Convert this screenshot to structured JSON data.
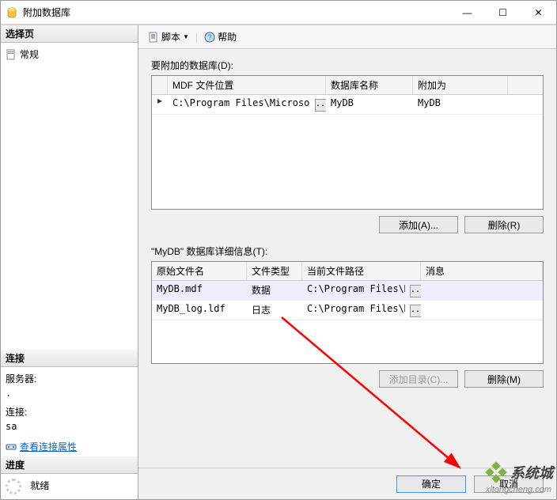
{
  "window": {
    "title": "附加数据库"
  },
  "titlebar_controls": {
    "min": "—",
    "max": "☐",
    "close": "✕"
  },
  "sidebar": {
    "select_page_header": "选择页",
    "general_item": "常规",
    "connection_header": "连接",
    "server_label": "服务器:",
    "server_value": ".",
    "conn_label": "连接:",
    "conn_value": "sa",
    "view_props_link": "查看连接属性",
    "progress_header": "进度",
    "ready_label": "就绪"
  },
  "toolbar": {
    "script_label": "脚本",
    "help_label": "帮助"
  },
  "databases": {
    "label": "要附加的数据库(D):",
    "columns": {
      "mdf": "MDF 文件位置",
      "dbname": "数据库名称",
      "attachas": "附加为"
    },
    "rows": [
      {
        "mdf": "C:\\Program Files\\Microsoft ...",
        "dbname": "MyDB",
        "attachas": "MyDB"
      }
    ],
    "add_btn": "添加(A)...",
    "remove_btn": "删除(R)"
  },
  "details": {
    "label": "\"MyDB\" 数据库详细信息(T):",
    "columns": {
      "orig": "原始文件名",
      "type": "文件类型",
      "path": "当前文件路径",
      "msg": "消息"
    },
    "rows": [
      {
        "orig": "MyDB.mdf",
        "type": "数据",
        "path": "C:\\Program Files\\M..."
      },
      {
        "orig": "MyDB_log.ldf",
        "type": "日志",
        "path": "C:\\Program Files\\M..."
      }
    ],
    "add_dir_btn": "添加目录(C)...",
    "remove_btn": "删除(M)"
  },
  "footer": {
    "ok": "确定",
    "cancel": "取消"
  },
  "watermark": {
    "text": "系统城",
    "url": "xitongcheng.com"
  }
}
